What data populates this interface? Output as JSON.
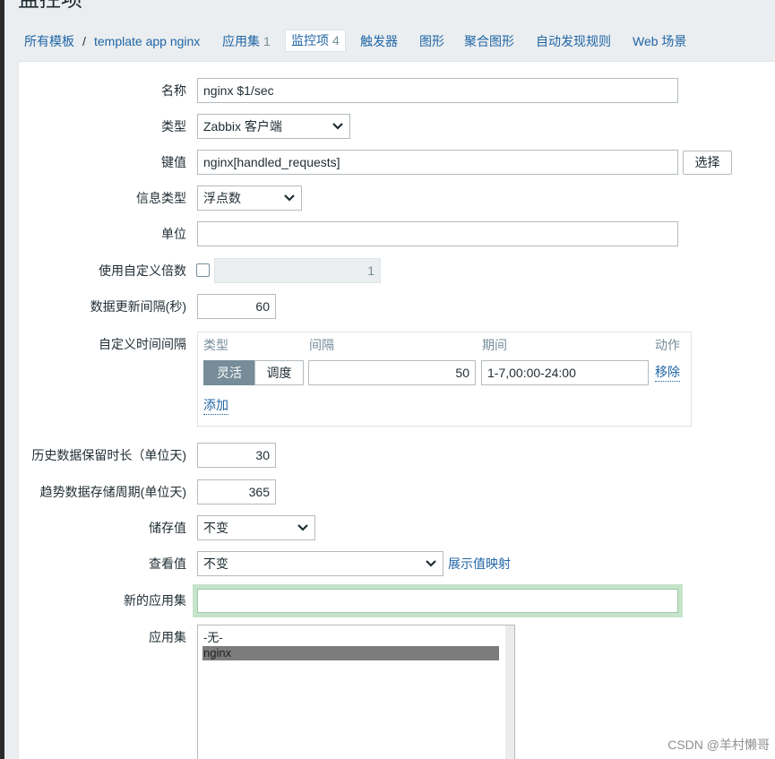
{
  "page": {
    "title": "监控项"
  },
  "nav": {
    "breadcrumb": [
      "所有模板",
      "template app nginx"
    ],
    "separator": "/",
    "tabs": [
      {
        "label": "应用集",
        "count": "1",
        "active": false
      },
      {
        "label": "监控项",
        "count": "4",
        "active": true
      },
      {
        "label": "触发器",
        "active": false
      },
      {
        "label": "图形",
        "active": false
      },
      {
        "label": "聚合图形",
        "active": false
      },
      {
        "label": "自动发现规则",
        "active": false
      },
      {
        "label": "Web 场景",
        "active": false
      }
    ]
  },
  "form": {
    "name": {
      "label": "名称",
      "value": "nginx $1/sec"
    },
    "type": {
      "label": "类型",
      "value": "Zabbix 客户端"
    },
    "key": {
      "label": "键值",
      "value": "nginx[handled_requests]",
      "select_button": "选择"
    },
    "value_type": {
      "label": "信息类型",
      "value": "浮点数"
    },
    "units": {
      "label": "单位",
      "value": ""
    },
    "multiplier": {
      "label": "使用自定义倍数",
      "checked": false,
      "value": "1"
    },
    "update_interval": {
      "label": "数据更新间隔(秒)",
      "value": "60"
    },
    "custom_intervals": {
      "label": "自定义时间间隔",
      "columns": {
        "type": "类型",
        "interval": "间隔",
        "period": "期间",
        "action": "动作"
      },
      "rows": [
        {
          "modes": [
            {
              "label": "灵活",
              "selected": true
            },
            {
              "label": "调度",
              "selected": false
            }
          ],
          "interval": "50",
          "period": "1-7,00:00-24:00",
          "remove_label": "移除"
        }
      ],
      "add_label": "添加"
    },
    "history": {
      "label": "历史数据保留时长（单位天)",
      "value": "30"
    },
    "trends": {
      "label": "趋势数据存储周期(单位天)",
      "value": "365"
    },
    "store_value": {
      "label": "储存值",
      "value": "不变"
    },
    "show_value": {
      "label": "查看值",
      "value": "不变",
      "value_mapping_link": "展示值映射"
    },
    "new_application": {
      "label": "新的应用集",
      "value": "",
      "focused": true
    },
    "applications": {
      "label": "应用集",
      "options": [
        {
          "label": "-无-",
          "selected": false
        },
        {
          "label": "nginx",
          "selected": true
        }
      ]
    }
  },
  "watermark": "CSDN @羊村懒哥",
  "icons": {
    "select_arrow": "chevron-down-icon"
  },
  "colors": {
    "page_bg": "#ebeef0",
    "text": "#1f2c33",
    "link": "#1f65a6",
    "muted": "#768d99",
    "active_segment": "#768d99",
    "focus_glow": "#c6e4cb",
    "selected_option": "#7c7c7c"
  }
}
